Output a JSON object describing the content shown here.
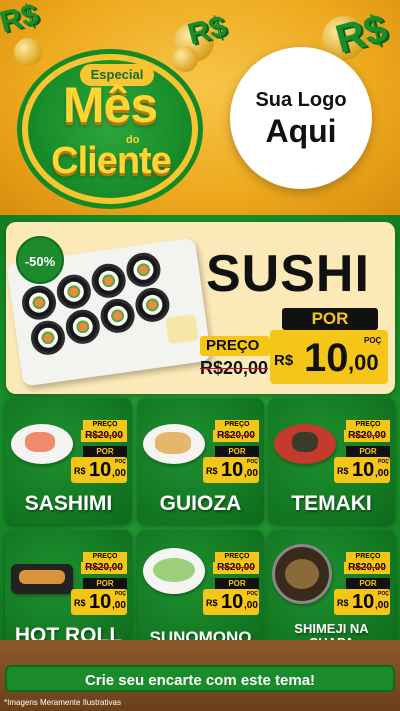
{
  "header": {
    "badge": {
      "especial": "Especial",
      "mes": "Mês",
      "do": "do",
      "cliente": "Cliente"
    },
    "logo": {
      "line1": "Sua Logo",
      "line2": "Aqui"
    },
    "coin_symbol": "R$"
  },
  "hero": {
    "discount": "-50%",
    "title": "SUSHI",
    "por": "POR",
    "preco_label": "PREÇO",
    "old_price": "R$20,00",
    "currency": "R$",
    "price_int": "10",
    "price_cents": ",00",
    "poc": "POÇ"
  },
  "cards": [
    {
      "name": "SASHIMI",
      "preco": "PREÇO",
      "old": "R$20,00",
      "por": "POR",
      "cur": "R$",
      "int": "10",
      "cents": ",00",
      "poc": "POÇ"
    },
    {
      "name": "GUIOZA",
      "preco": "PREÇO",
      "old": "R$20,00",
      "por": "POR",
      "cur": "R$",
      "int": "10",
      "cents": ",00",
      "poc": "POÇ"
    },
    {
      "name": "TEMAKI",
      "preco": "PREÇO",
      "old": "R$20,00",
      "por": "POR",
      "cur": "R$",
      "int": "10",
      "cents": ",00",
      "poc": "POÇ"
    },
    {
      "name": "HOT ROLL",
      "preco": "PREÇO",
      "old": "R$20,00",
      "por": "POR",
      "cur": "R$",
      "int": "10",
      "cents": ",00",
      "poc": "POÇ"
    },
    {
      "name": "SUNOMONO",
      "preco": "PREÇO",
      "old": "R$20,00",
      "por": "POR",
      "cur": "R$",
      "int": "10",
      "cents": ",00",
      "poc": "POÇ"
    },
    {
      "name": "SHIMEJI NA CHAPA",
      "preco": "PREÇO",
      "old": "R$20,00",
      "por": "POR",
      "cur": "R$",
      "int": "10",
      "cents": ",00",
      "poc": "POÇ"
    }
  ],
  "footer": {
    "cta": "Crie seu encarte com este tema!",
    "note": "*Imagens Meramente Ilustrativas"
  },
  "colors": {
    "green": "#1e9130",
    "yellow": "#f5c518",
    "orange": "#eea91e"
  }
}
